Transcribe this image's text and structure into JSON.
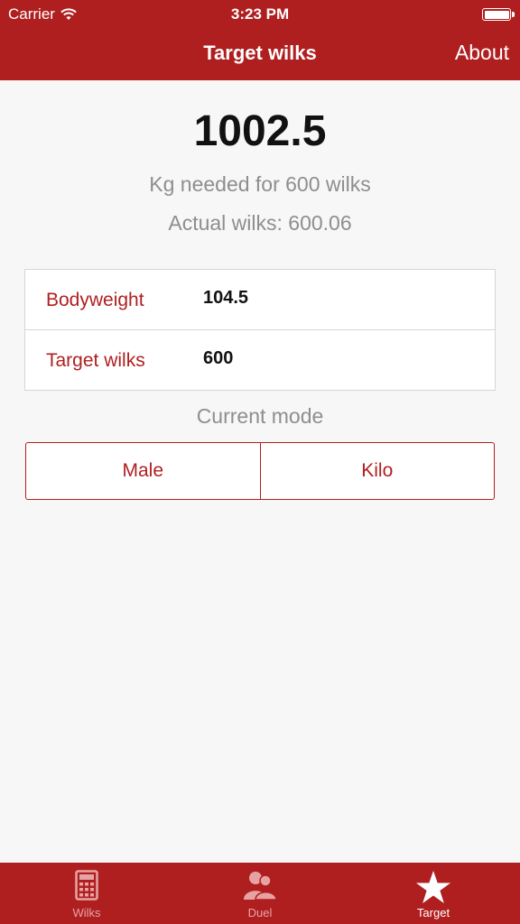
{
  "status_bar": {
    "carrier": "Carrier",
    "time": "3:23 PM"
  },
  "nav": {
    "title": "Target wilks",
    "about_label": "About"
  },
  "result": {
    "value": "1002.5",
    "subtitle": "Kg needed for 600 wilks",
    "actual": "Actual wilks: 600.06"
  },
  "form": {
    "rows": [
      {
        "label": "Bodyweight",
        "value": "104.5"
      },
      {
        "label": "Target wilks",
        "value": "600"
      }
    ]
  },
  "mode": {
    "title": "Current mode",
    "options": [
      {
        "label": "Male"
      },
      {
        "label": "Kilo"
      }
    ]
  },
  "tabs": [
    {
      "label": "Wilks",
      "icon": "calculator-icon",
      "active": false
    },
    {
      "label": "Duel",
      "icon": "people-icon",
      "active": false
    },
    {
      "label": "Target",
      "icon": "star-icon",
      "active": true
    }
  ],
  "colors": {
    "accent": "#b01f20",
    "background": "#f7f7f7",
    "muted_text": "#8e8e8e"
  }
}
